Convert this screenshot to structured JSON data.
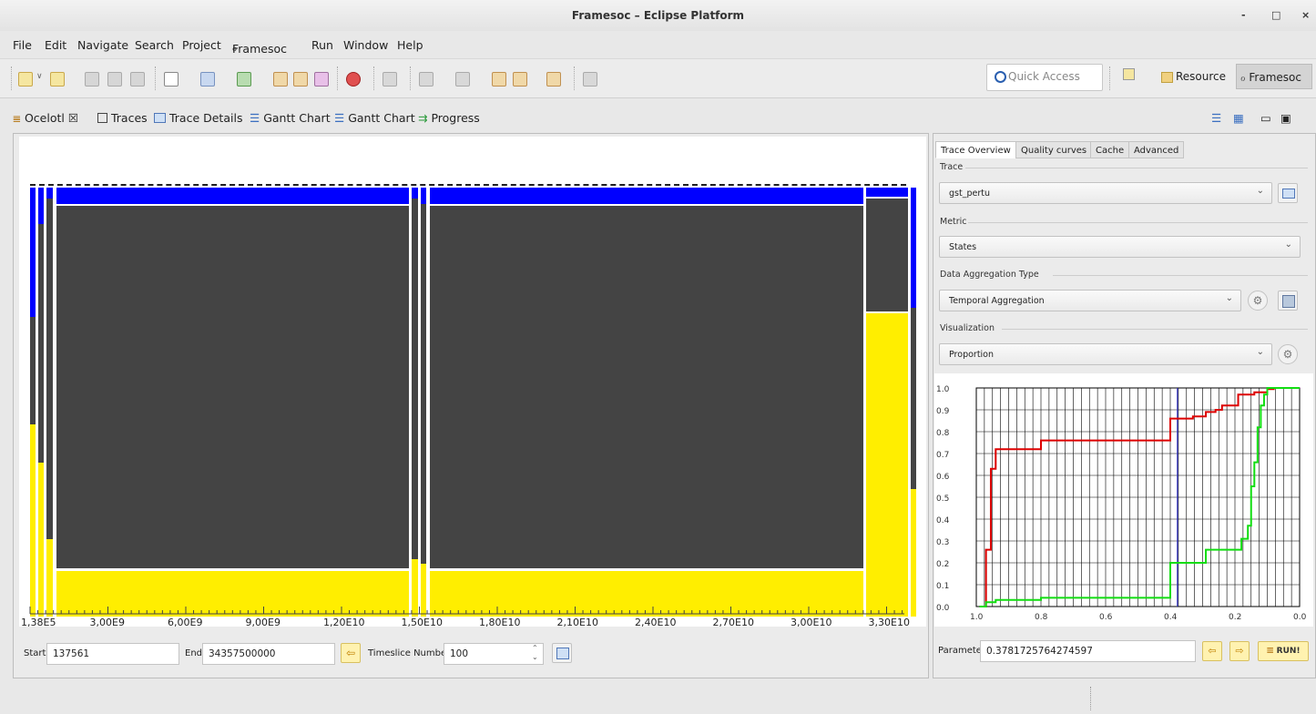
{
  "window": {
    "title": "Framesoc – Eclipse Platform",
    "min": "-",
    "max": "□",
    "close": "×"
  },
  "menu": [
    "File",
    "Edit",
    "Navigate",
    "Search",
    "Project",
    "Framesoc",
    "Run",
    "Window",
    "Help"
  ],
  "quick_access": {
    "placeholder": "Quick Access"
  },
  "perspectives": {
    "resource": "Resource",
    "framesoc": "Framesoc"
  },
  "tabs": [
    {
      "label": "Ocelotl ☒",
      "icon": "ocelotl-icon"
    },
    {
      "label": "Traces",
      "icon": "traces-icon"
    },
    {
      "label": "Trace Details",
      "icon": "trace-details-icon"
    },
    {
      "label": "Gantt Chart",
      "icon": "gantt-icon"
    },
    {
      "label": "Gantt Chart",
      "icon": "gantt-icon"
    },
    {
      "label": "Progress",
      "icon": "progress-icon"
    }
  ],
  "timeline": {
    "ticks": [
      "1,38E5",
      "3,00E9",
      "6,00E9",
      "9,00E9",
      "1,20E10",
      "1,50E10",
      "1,80E10",
      "2,10E10",
      "2,40E10",
      "2,70E10",
      "3,00E10",
      "3,30E10"
    ]
  },
  "bottom": {
    "start_label": "Start",
    "start_value": "137561",
    "end_label": "End",
    "end_value": "34357500000",
    "timeslice_label": "Timeslice Number",
    "timeslice_value": "100"
  },
  "right_tabs": [
    "Trace Overview",
    "Quality curves",
    "Cache",
    "Advanced"
  ],
  "settings": {
    "trace_label": "Trace",
    "trace_value": "gst_pertu",
    "metric_label": "Metric",
    "metric_value": "States",
    "aggregation_label": "Data Aggregation Type",
    "aggregation_value": "Temporal Aggregation",
    "visualization_label": "Visualization",
    "visualization_value": "Proportion"
  },
  "parameter": {
    "label": "Parameter",
    "value": "0.3781725764274597",
    "run_label": "RUN!"
  },
  "colors": {
    "running": "#0000ff",
    "idle": "#444444",
    "other": "#ffee00",
    "red_curve": "#dd0000",
    "green_curve": "#11dd11"
  },
  "chart_data": {
    "type": "line",
    "x_ticks": [
      "1.0",
      "0.8",
      "0.6",
      "0.4",
      "0.2",
      "0.0"
    ],
    "y_ticks": [
      "1.0",
      "0.9",
      "0.8",
      "0.7",
      "0.6",
      "0.5",
      "0.4",
      "0.3",
      "0.2",
      "0.1",
      "0.0"
    ],
    "xlim": [
      1.0,
      0.0
    ],
    "ylim": [
      0.0,
      1.0
    ],
    "grid": true,
    "marker_x": 0.378,
    "series": [
      {
        "color": "red",
        "x": [
          0.99,
          0.97,
          0.97,
          0.955,
          0.955,
          0.94,
          0.94,
          0.8,
          0.8,
          0.4,
          0.4,
          0.33,
          0.33,
          0.29,
          0.29,
          0.26,
          0.26,
          0.24,
          0.24,
          0.19,
          0.19,
          0.14,
          0.14,
          0.1,
          0.1,
          0.08,
          0.08,
          0.0
        ],
        "y": [
          0.0,
          0.0,
          0.26,
          0.26,
          0.63,
          0.63,
          0.72,
          0.72,
          0.76,
          0.76,
          0.86,
          0.86,
          0.87,
          0.87,
          0.89,
          0.89,
          0.9,
          0.9,
          0.92,
          0.92,
          0.97,
          0.97,
          0.98,
          0.98,
          0.995,
          0.995,
          1.0,
          1.0
        ]
      },
      {
        "color": "green",
        "x": [
          0.99,
          0.97,
          0.97,
          0.94,
          0.94,
          0.8,
          0.8,
          0.4,
          0.4,
          0.29,
          0.29,
          0.18,
          0.18,
          0.16,
          0.16,
          0.15,
          0.15,
          0.14,
          0.14,
          0.13,
          0.13,
          0.12,
          0.12,
          0.11,
          0.11,
          0.1,
          0.1,
          0.0
        ],
        "y": [
          0.0,
          0.0,
          0.02,
          0.02,
          0.03,
          0.03,
          0.04,
          0.04,
          0.2,
          0.2,
          0.26,
          0.26,
          0.31,
          0.31,
          0.37,
          0.37,
          0.55,
          0.55,
          0.66,
          0.66,
          0.82,
          0.82,
          0.92,
          0.92,
          0.97,
          0.97,
          1.0,
          1.0
        ]
      }
    ]
  }
}
